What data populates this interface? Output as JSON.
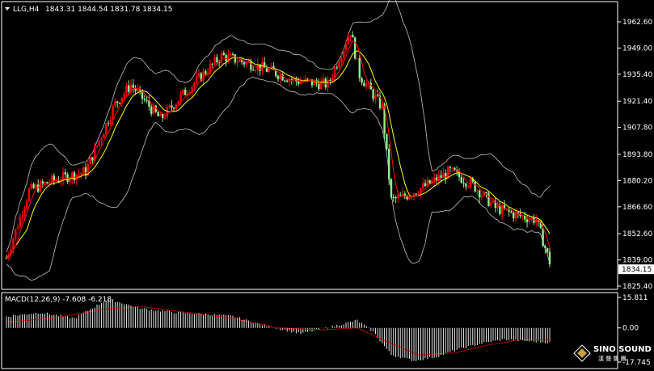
{
  "header": {
    "symbol_label": "LLG,H4",
    "ohlc_text": "1843.31 1844.54 1831.78 1834.15"
  },
  "price_axis": {
    "ticks": [
      "1962.60",
      "1949.00",
      "1935.40",
      "1921.40",
      "1907.80",
      "1893.80",
      "1880.20",
      "1866.60",
      "1852.60",
      "1839.00",
      "1825.40"
    ],
    "current_price": "1834.15"
  },
  "macd": {
    "label": "MACD(12,26,9) -7.608 -6.218",
    "ticks": [
      "15.811",
      "0.00",
      "-17.745"
    ]
  },
  "logo": {
    "name": "SINO SOUND",
    "sub": "漢 聲 集 團"
  },
  "colors": {
    "background": "#000000",
    "bull_candle": "#ff0000",
    "bear_candle": "#90ee90",
    "moving_average_1": "#ffff00",
    "moving_average_2": "#ff0000",
    "bollinger": "#c0c0c0",
    "macd_hist": "#ffffff",
    "macd_signal": "#ff0000"
  },
  "chart_data": {
    "type": "candlestick",
    "price_range": [
      1825.4,
      1962.6
    ],
    "price_keypoints": [
      [
        0,
        1840
      ],
      [
        10,
        1875
      ],
      [
        20,
        1880
      ],
      [
        35,
        1885
      ],
      [
        48,
        1920
      ],
      [
        55,
        1930
      ],
      [
        68,
        1912
      ],
      [
        78,
        1925
      ],
      [
        95,
        1945
      ],
      [
        110,
        1940
      ],
      [
        128,
        1932
      ],
      [
        142,
        1930
      ],
      [
        152,
        1958
      ],
      [
        156,
        1935
      ],
      [
        166,
        1918
      ],
      [
        170,
        1870
      ],
      [
        176,
        1872
      ],
      [
        186,
        1878
      ],
      [
        196,
        1885
      ],
      [
        206,
        1878
      ],
      [
        216,
        1866
      ],
      [
        226,
        1862
      ],
      [
        234,
        1860
      ],
      [
        240,
        1838
      ]
    ],
    "macd_keypoints": [
      [
        0,
        6
      ],
      [
        15,
        8
      ],
      [
        30,
        5
      ],
      [
        45,
        15
      ],
      [
        60,
        10
      ],
      [
        75,
        8
      ],
      [
        90,
        7
      ],
      [
        100,
        6
      ],
      [
        115,
        1
      ],
      [
        130,
        -3
      ],
      [
        145,
        1
      ],
      [
        155,
        4
      ],
      [
        162,
        -2
      ],
      [
        170,
        -14
      ],
      [
        180,
        -17
      ],
      [
        190,
        -15
      ],
      [
        200,
        -11
      ],
      [
        210,
        -8
      ],
      [
        220,
        -6
      ],
      [
        232,
        -7
      ],
      [
        240,
        -7.6
      ]
    ],
    "signal_keypoints": [
      [
        0,
        3
      ],
      [
        20,
        5
      ],
      [
        45,
        10
      ],
      [
        60,
        11
      ],
      [
        80,
        8
      ],
      [
        100,
        5
      ],
      [
        120,
        0
      ],
      [
        140,
        -1
      ],
      [
        155,
        0
      ],
      [
        170,
        -8
      ],
      [
        182,
        -14
      ],
      [
        198,
        -13
      ],
      [
        212,
        -9
      ],
      [
        228,
        -6
      ],
      [
        240,
        -6.2
      ]
    ],
    "macd_range": [
      -17.745,
      15.811
    ]
  }
}
